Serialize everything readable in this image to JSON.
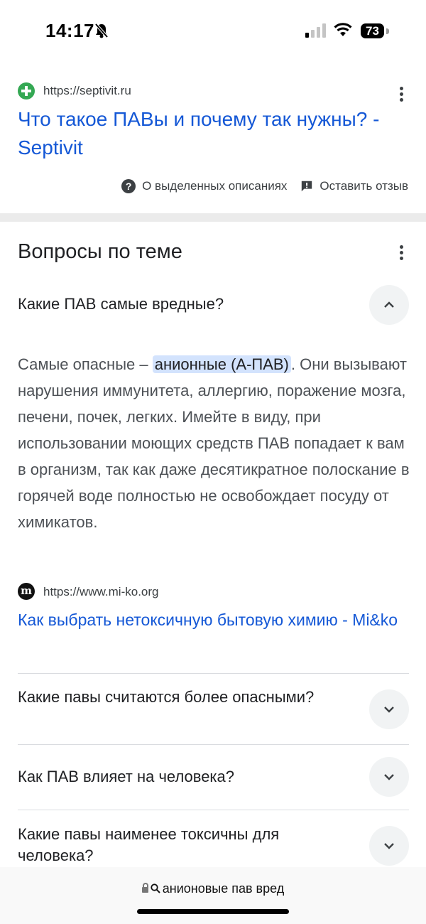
{
  "status_bar": {
    "time": "14:17",
    "battery": "73",
    "icons": [
      "bell-slash-icon",
      "signal-icon",
      "wifi-icon",
      "battery-icon"
    ]
  },
  "result": {
    "url": "https://septivit.ru",
    "title": "Что такое ПАВы и почему так нужны? - Septivit",
    "favicon": "green-plus-icon"
  },
  "feedback": {
    "about_label": "О выделенных описаниях",
    "leave_feedback_label": "Оставить отзыв"
  },
  "related_questions": {
    "heading": "Вопросы по теме",
    "expanded": {
      "question": "Какие ПАВ самые вредные?",
      "answer_before": "Самые опасные – ",
      "answer_highlight": "анионные (А-ПАВ)",
      "answer_after": ". Они вызывают нарушения иммунитета, аллергию, поражение мозга, печени, почек, легких. Имейте в виду, при использовании моющих средств ПАВ попадает к вам в организм, так как даже десятикратное полоскание в горячей воде полностью не освобождает посуду от химикатов.",
      "source_url": "https://www.mi-ko.org",
      "source_icon_letter": "m",
      "source_title": "Как выбрать нетоксичную бытовую химию - Mi&ko"
    },
    "collapsed": [
      {
        "question": "Какие павы считаются более опасными?"
      },
      {
        "question": "Как ПАВ влияет на человека?"
      },
      {
        "question": "Какие павы наименее токсичны для человека?"
      }
    ]
  },
  "address_bar": {
    "text": "анионовые пав вред"
  },
  "colors": {
    "link": "#1558d6",
    "highlight": "#d3e3fd",
    "toggle_bg": "#f1f3f4"
  }
}
